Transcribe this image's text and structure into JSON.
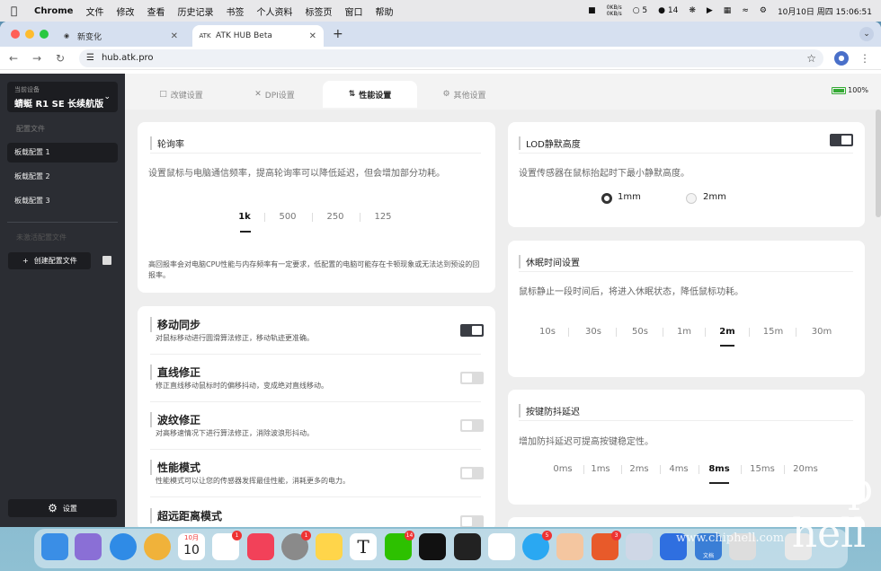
{
  "menubar": {
    "app": "Chrome",
    "items": [
      "文件",
      "修改",
      "查看",
      "历史记录",
      "书签",
      "个人资料",
      "标签页",
      "窗口",
      "帮助"
    ],
    "net_up": "0KB/s",
    "net_down": "0KB/s",
    "msg_count": "5",
    "wechat_count": "14",
    "datetime": "10月10日 周四  15:06:51"
  },
  "browser": {
    "tabs": [
      {
        "title": "新变化",
        "favicon": "chrome-icon"
      },
      {
        "title": "ATK HUB Beta",
        "favicon": "ATK"
      }
    ],
    "url": "hub.atk.pro"
  },
  "sidebar": {
    "device_label": "当前设备",
    "device_name": "蜻蜓 R1 SE 长续航版",
    "profiles_title": "配置文件",
    "profiles": [
      "板载配置 1",
      "板载配置 2",
      "板载配置 3"
    ],
    "inactive_title": "未激活配置文件",
    "create_label": "创建配置文件",
    "settings_label": "设置"
  },
  "top_tabs": [
    {
      "label": "改键设置",
      "icon": "keyboard-icon"
    },
    {
      "label": "DPI设置",
      "icon": "crosshair-icon"
    },
    {
      "label": "性能设置",
      "icon": "sliders-icon"
    },
    {
      "label": "其他设置",
      "icon": "gear-icon"
    }
  ],
  "battery": {
    "label": "100%",
    "level": 1.0
  },
  "polling": {
    "title": "轮询率",
    "desc": "设置鼠标与电脑通信频率，提高轮询率可以降低延迟，但会增加部分功耗。",
    "options": [
      "1k",
      "500",
      "250",
      "125"
    ],
    "selected": "1k",
    "note": "高回报率会对电脑CPU性能与内存频率有一定要求，低配置的电脑可能存在卡顿现象或无法达到预设的回报率。"
  },
  "toggles": [
    {
      "title": "移动同步",
      "desc": "对鼠标移动进行圆滑算法修正，移动轨迹更准确。",
      "on": true
    },
    {
      "title": "直线修正",
      "desc": "修正直线移动鼠标时的偏移抖动，变成绝对直线移动。",
      "on": false
    },
    {
      "title": "波纹修正",
      "desc": "对高移速情况下进行算法修正，消除波浪形抖动。",
      "on": false
    },
    {
      "title": "性能模式",
      "desc": "性能模式可以让您的传感器发挥最佳性能，消耗更多的电力。",
      "on": false
    },
    {
      "title": "超远距离模式",
      "desc": "",
      "on": false
    }
  ],
  "lod": {
    "title": "LOD静默高度",
    "desc": "设置传感器在鼠标抬起时下最小静默高度。",
    "options": [
      "1mm",
      "2mm"
    ],
    "selected": "1mm",
    "enabled": true
  },
  "sleep": {
    "title": "休眠时间设置",
    "desc": "鼠标静止一段时间后，将进入休眠状态，降低鼠标功耗。",
    "options": [
      "10s",
      "30s",
      "50s",
      "1m",
      "2m",
      "15m",
      "30m"
    ],
    "selected": "2m"
  },
  "debounce": {
    "title": "按键防抖延迟",
    "desc": "增加防抖延迟可提高按键稳定性。",
    "options": [
      "0ms",
      "1ms",
      "2ms",
      "4ms",
      "8ms",
      "15ms",
      "20ms"
    ],
    "selected": "8ms"
  },
  "dock": {
    "calendar_month": "10月",
    "calendar_day": "10",
    "badges": {
      "reminders": "1",
      "settings": "1",
      "wechat": "14",
      "qq": "5",
      "apps": "3"
    },
    "doc_label": "文档"
  },
  "watermark": "www.chiphell.com",
  "logo": "chip hell"
}
